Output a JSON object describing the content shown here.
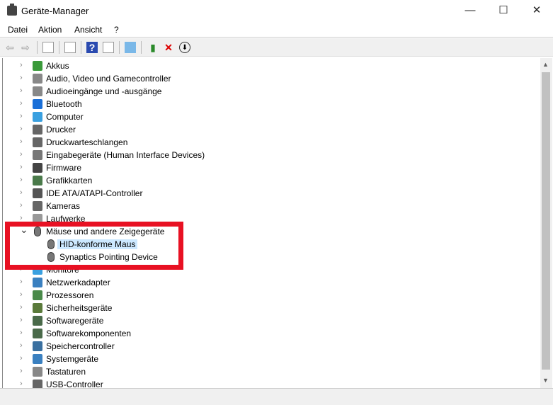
{
  "window": {
    "title": "Geräte-Manager",
    "minimize": "—",
    "maximize": "☐",
    "close": "✕"
  },
  "menu": [
    "Datei",
    "Aktion",
    "Ansicht",
    "?"
  ],
  "toolbar": [
    "back-icon",
    "forward-icon",
    "show-hide-console-tree-icon",
    "properties-icon",
    "help-icon",
    "action-pane-icon",
    "scan-hardware-icon",
    "update-driver-icon",
    "uninstall-icon",
    "disable-icon"
  ],
  "tree": {
    "items": [
      {
        "label": "Akkus",
        "color": "#3a9a3a"
      },
      {
        "label": "Audio, Video und Gamecontroller",
        "color": "#888"
      },
      {
        "label": "Audioeingänge und -ausgänge",
        "color": "#888"
      },
      {
        "label": "Bluetooth",
        "color": "#1a6fd8"
      },
      {
        "label": "Computer",
        "color": "#3aa0e0"
      },
      {
        "label": "Drucker",
        "color": "#666"
      },
      {
        "label": "Druckwarteschlangen",
        "color": "#666"
      },
      {
        "label": "Eingabegeräte (Human Interface Devices)",
        "color": "#777"
      },
      {
        "label": "Firmware",
        "color": "#444"
      },
      {
        "label": "Grafikkarten",
        "color": "#4a7a4a"
      },
      {
        "label": "IDE ATA/ATAPI-Controller",
        "color": "#555"
      },
      {
        "label": "Kameras",
        "color": "#666"
      },
      {
        "label": "Laufwerke",
        "color": "#999"
      },
      {
        "label": "Mäuse und andere Zeigegeräte",
        "color": "#777",
        "expanded": true
      },
      {
        "label": "HID-konforme Maus",
        "child": true,
        "selected": true
      },
      {
        "label": "Synaptics Pointing Device",
        "child": true
      },
      {
        "label": "Monitore",
        "color": "#3aa0e0"
      },
      {
        "label": "Netzwerkadapter",
        "color": "#3a80c0"
      },
      {
        "label": "Prozessoren",
        "color": "#4a8a4a"
      },
      {
        "label": "Sicherheitsgeräte",
        "color": "#5a7a3a"
      },
      {
        "label": "Softwaregeräte",
        "color": "#4a6a4a"
      },
      {
        "label": "Softwarekomponenten",
        "color": "#4a6a4a"
      },
      {
        "label": "Speichercontroller",
        "color": "#3a70a0"
      },
      {
        "label": "Systemgeräte",
        "color": "#3a80c0"
      },
      {
        "label": "Tastaturen",
        "color": "#888"
      },
      {
        "label": "USB-Controller",
        "color": "#666"
      }
    ]
  },
  "scroll": {
    "up": "▲",
    "down": "▼"
  },
  "highlight_color": "#e81123"
}
